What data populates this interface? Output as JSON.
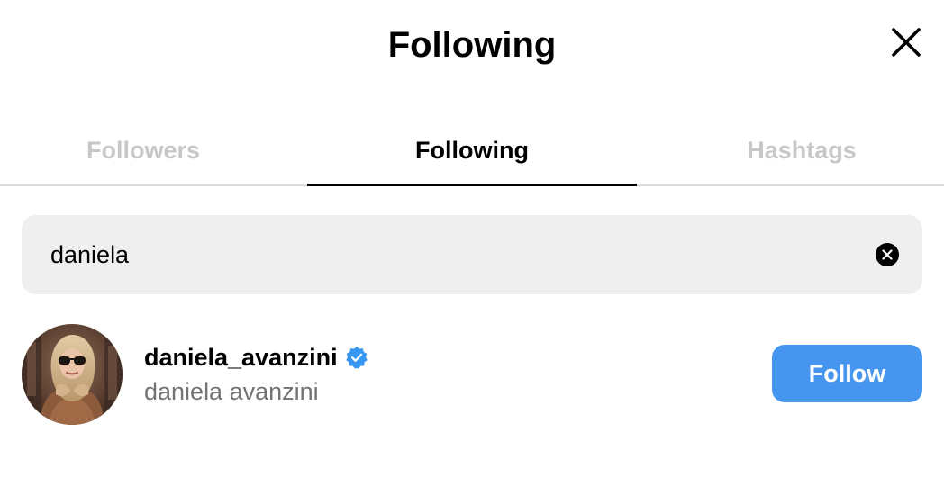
{
  "header": {
    "title": "Following",
    "close_icon": "close-icon"
  },
  "tabs": [
    {
      "label": "Followers",
      "active": false
    },
    {
      "label": "Following",
      "active": true
    },
    {
      "label": "Hashtags",
      "active": false
    }
  ],
  "search": {
    "value": "daniela",
    "placeholder": "Search",
    "clear_icon": "clear-circle-icon"
  },
  "results": [
    {
      "username": "daniela_avanzini",
      "full_name": "daniela avanzini",
      "verified": true,
      "verified_icon": "verified-badge-icon",
      "action_label": "Follow"
    }
  ],
  "colors": {
    "accent": "#4695ee",
    "verified": "#3897f0",
    "inactive_tab": "#c7c7c7",
    "secondary_text": "#737373",
    "search_bg": "#efefef",
    "divider": "#dbdbdb"
  }
}
